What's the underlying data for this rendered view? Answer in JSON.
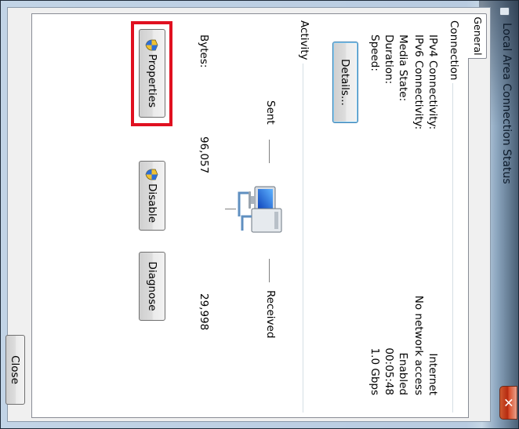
{
  "window": {
    "title": "Local Area Connection Status",
    "close_glyph": "✕"
  },
  "tabs": [
    {
      "label": "General"
    }
  ],
  "connection": {
    "group_label": "Connection",
    "rows": [
      {
        "label": "IPv4 Connectivity:",
        "value": "Internet"
      },
      {
        "label": "IPv6 Connectivity:",
        "value": "No network access"
      },
      {
        "label": "Media State:",
        "value": "Enabled"
      },
      {
        "label": "Duration:",
        "value": "00:05:48"
      },
      {
        "label": "Speed:",
        "value": "1.0 Gbps"
      }
    ],
    "details_button": "Details..."
  },
  "activity": {
    "group_label": "Activity",
    "sent_label": "Sent",
    "received_label": "Received",
    "bytes_label": "Bytes:",
    "sent_bytes": "96,057",
    "received_bytes": "29,998"
  },
  "buttons": {
    "properties": "Properties",
    "disable": "Disable",
    "diagnose": "Diagnose",
    "close": "Close"
  },
  "colors": {
    "highlight": "#e01020",
    "title_bar": "#b8cbe0",
    "close_button": "#d9502e"
  }
}
